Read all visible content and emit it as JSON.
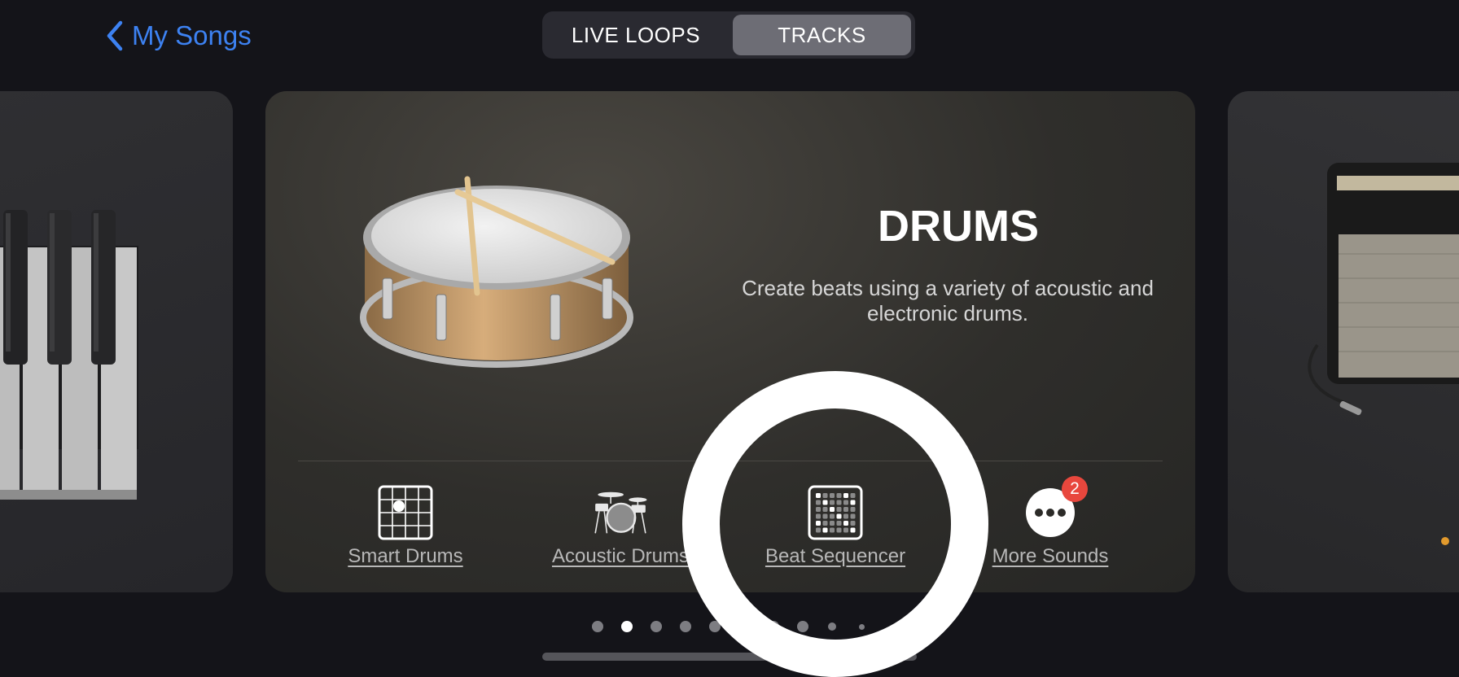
{
  "nav": {
    "back_label": "My Songs"
  },
  "segments": {
    "left_label": "LIVE LOOPS",
    "right_label": "TRACKS",
    "selected": "TRACKS"
  },
  "card": {
    "title": "DRUMS",
    "description": "Create beats using a variety of acoustic and electronic drums."
  },
  "options": [
    {
      "label": "Smart Drums",
      "icon": "smart-drums-grid-icon"
    },
    {
      "label": "Acoustic Drums",
      "icon": "drum-kit-icon"
    },
    {
      "label": "Beat Sequencer",
      "icon": "beat-sequencer-icon"
    },
    {
      "label": "More Sounds",
      "icon": "ellipsis-icon",
      "badge": "2"
    }
  ],
  "pager": {
    "total": 10,
    "current": 2
  },
  "colors": {
    "accent": "#3d82f2",
    "badge": "#e8473d",
    "background": "#141419"
  }
}
